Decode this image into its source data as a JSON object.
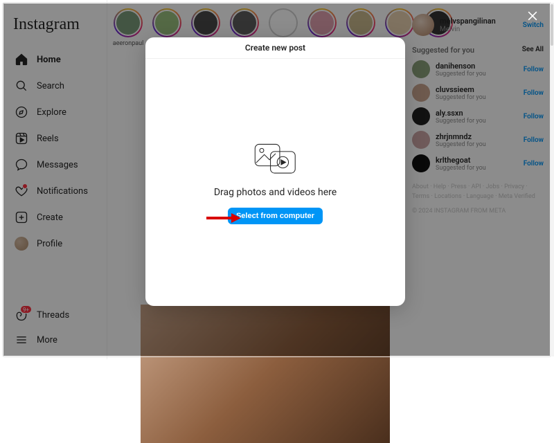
{
  "brand": "Instagram",
  "nav": {
    "home": "Home",
    "search": "Search",
    "explore": "Explore",
    "reels": "Reels",
    "messages": "Messages",
    "notifications": "Notifications",
    "create": "Create",
    "profile": "Profile",
    "threads": "Threads",
    "more": "More",
    "threads_badge": "9+"
  },
  "stories": [
    {
      "user": "aeeronpaul"
    },
    {
      "user": ""
    },
    {
      "user": ""
    },
    {
      "user": ""
    },
    {
      "user": ""
    },
    {
      "user": ""
    },
    {
      "user": ""
    },
    {
      "user": ""
    },
    {
      "user": ""
    }
  ],
  "me": {
    "username": "melvspangilinan",
    "name": "Melvin",
    "switch": "Switch"
  },
  "suggestions": {
    "header": "Suggested for you",
    "see_all": "See All",
    "follow": "Follow",
    "subtext": "Suggested for you",
    "items": [
      {
        "user": "danihenson"
      },
      {
        "user": "cluvssieem"
      },
      {
        "user": "aly.ssxn"
      },
      {
        "user": "zhrjnmndz"
      },
      {
        "user": "krlthegoat"
      }
    ]
  },
  "footer": {
    "links": [
      "About",
      "Help",
      "Press",
      "API",
      "Jobs",
      "Privacy",
      "Terms",
      "Locations",
      "Language",
      "Meta Verified"
    ],
    "copyright": "© 2024 INSTAGRAM FROM META"
  },
  "modal": {
    "title": "Create new post",
    "drag_text": "Drag photos and videos here",
    "select_button": "Select from computer"
  }
}
